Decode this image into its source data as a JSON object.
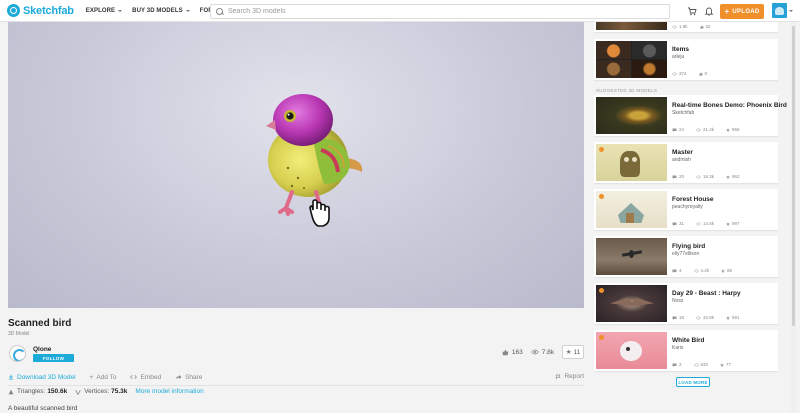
{
  "header": {
    "logo_text": "Sketchfab",
    "nav": [
      {
        "label": "EXPLORE"
      },
      {
        "label": "BUY 3D MODELS"
      },
      {
        "label": "FOR BUSINESS"
      }
    ],
    "search_placeholder": "Search 3D models",
    "upload_label": "UPLOAD"
  },
  "model": {
    "title": "Scanned bird",
    "subtitle": "3D Model",
    "author": "Qlone",
    "follow_label": "FOLLOW",
    "likes": "163",
    "views": "7.8k",
    "stars": "11",
    "actions": {
      "download": "Download 3D Model",
      "add_to": "Add To",
      "embed": "Embed",
      "share": "Share",
      "report": "Report"
    },
    "triangles_label": "Triangles:",
    "triangles": "150.6k",
    "vertices_label": "Vertices:",
    "vertices": "75.3k",
    "more_info": "More model information",
    "description": "A beautiful scanned bird"
  },
  "sidebar": {
    "top_cards": [
      {
        "title": "",
        "author": "",
        "likes": "1.8k",
        "views": "32"
      },
      {
        "title": "Items",
        "author": "arleju",
        "likes": "374",
        "views": "0"
      }
    ],
    "suggested_label": "SUGGESTED 3D MODELS",
    "suggested": [
      {
        "title": "Real-time Bones Demo: Phoenix Bird",
        "author": "Sketchfab",
        "comments": "24",
        "views": "21.4k",
        "likes": "556"
      },
      {
        "title": "Master",
        "author": "andmish",
        "comments": "20",
        "views": "16.3k",
        "likes": "962"
      },
      {
        "title": "Forest House",
        "author": "peachyroyalty",
        "comments": "31",
        "views": "14.5k",
        "likes": "997"
      },
      {
        "title": "Flying bird",
        "author": "elly77ellison",
        "comments": "4",
        "views": "4.2k",
        "likes": "88"
      },
      {
        "title": "Day 29 - Beast : Harpy",
        "author": "Noss",
        "comments": "18",
        "views": "32.8k",
        "likes": "591"
      },
      {
        "title": "White Bird",
        "author": "Karis",
        "comments": "2",
        "views": "632",
        "likes": "77"
      }
    ],
    "load_more_label": "LOAD MORE"
  },
  "colors": {
    "brand": "#1caad9",
    "upload": "#f0902b"
  }
}
